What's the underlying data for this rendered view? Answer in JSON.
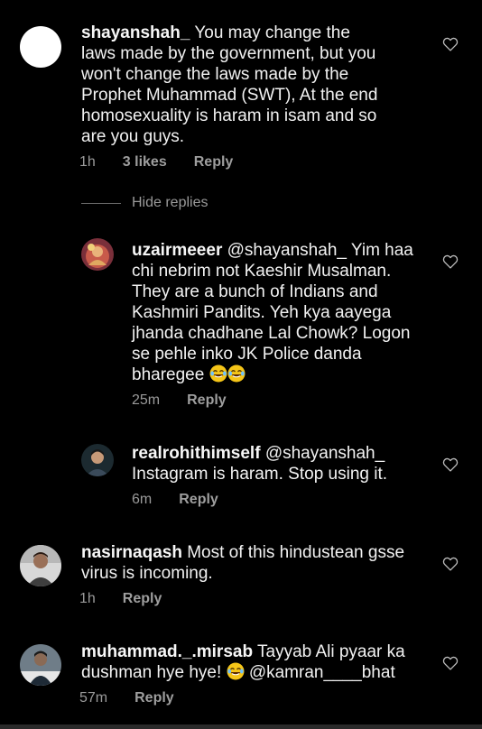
{
  "comments": [
    {
      "username": "shayanshah_",
      "text": "You may change the laws made by the government, but you won't change the laws made by the Prophet Muhammad (SWT), At the end homosexuality is haram in isam and so are you guys.",
      "time": "1h",
      "likes": "3 likes",
      "reply": "Reply"
    },
    {
      "username": "uzairmeeer",
      "text": "@shayanshah_ Yim haa chi nebrim not Kaeshir Musalman. They are a bunch of Indians and Kashmiri Pandits. Yeh kya aayega jhanda chadhane Lal Chowk? Logon se pehle inko JK Police danda bharegee",
      "emoji_count": 2,
      "time": "25m",
      "reply": "Reply"
    },
    {
      "username": "realrohithimself",
      "text": "@shayanshah_ Instagram is haram. Stop using it.",
      "time": "6m",
      "reply": "Reply"
    },
    {
      "username": "nasirnaqash",
      "text": "Most of this hindustean gsse virus is incoming.",
      "time": "1h",
      "reply": "Reply"
    },
    {
      "username": "muhammad._.mirsab",
      "text_before_emoji": "Tayyab Ali pyaar ka dushman hye hye!",
      "text_after_emoji": "@kamran____bhat",
      "time": "57m",
      "reply": "Reply"
    }
  ],
  "hide_replies": "Hide replies",
  "icons": {
    "like": "heart-outline-icon",
    "laugh_emoji": "face-with-tears-of-joy-icon"
  },
  "colors": {
    "background": "#000000",
    "text": "#f2f2f2",
    "secondary": "#9a9a9a",
    "emoji": "#f5c518"
  }
}
